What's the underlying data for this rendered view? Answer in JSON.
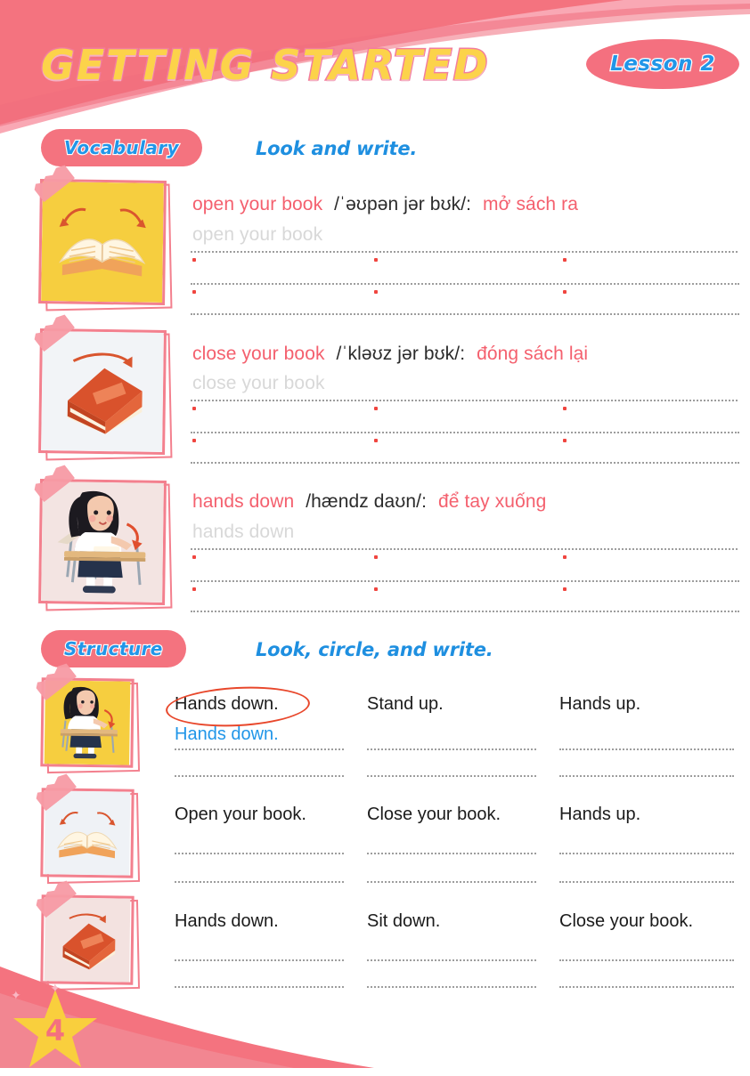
{
  "page": {
    "title": "GETTING STARTED",
    "lesson_badge": "Lesson 2",
    "page_number": "4",
    "colors": {
      "pink": "#F4737F",
      "title_yellow": "#FCD34A",
      "title_outline": "#F27D9D",
      "blue": "#2196E8",
      "coral": "#F4606E",
      "circle_red": "#E8472B"
    }
  },
  "vocabulary": {
    "pill_label": "Vocabulary",
    "instruction": "Look and write.",
    "items": [
      {
        "english": "open your book",
        "ipa": "/ˈəʊpən jər bʊk/:",
        "vietnamese": "mở sách ra",
        "trace": "open your book",
        "image": "open-book-illustration"
      },
      {
        "english": "close your book",
        "ipa": "/ˈkləʊz jər bʊk/:",
        "vietnamese": "đóng sách lại",
        "trace": "close your book",
        "image": "closed-book-illustration"
      },
      {
        "english": "hands down",
        "ipa": "/hændz daʊn/:",
        "vietnamese": "để tay xuống",
        "trace": "hands down",
        "image": "girl-at-desk-illustration"
      }
    ]
  },
  "structure": {
    "pill_label": "Structure",
    "instruction": "Look, circle, and write.",
    "rows": [
      {
        "image": "girl-at-desk-thumbnail",
        "options": [
          "Hands down.",
          "Stand up.",
          "Hands up."
        ],
        "circled_index": 0,
        "answer": "Hands down."
      },
      {
        "image": "open-book-thumbnail",
        "options": [
          "Open your book.",
          "Close your book.",
          "Hands up."
        ],
        "circled_index": -1,
        "answer": ""
      },
      {
        "image": "closed-book-thumbnail",
        "options": [
          "Hands down.",
          "Sit down.",
          "Close your book."
        ],
        "circled_index": -1,
        "answer": ""
      }
    ]
  }
}
